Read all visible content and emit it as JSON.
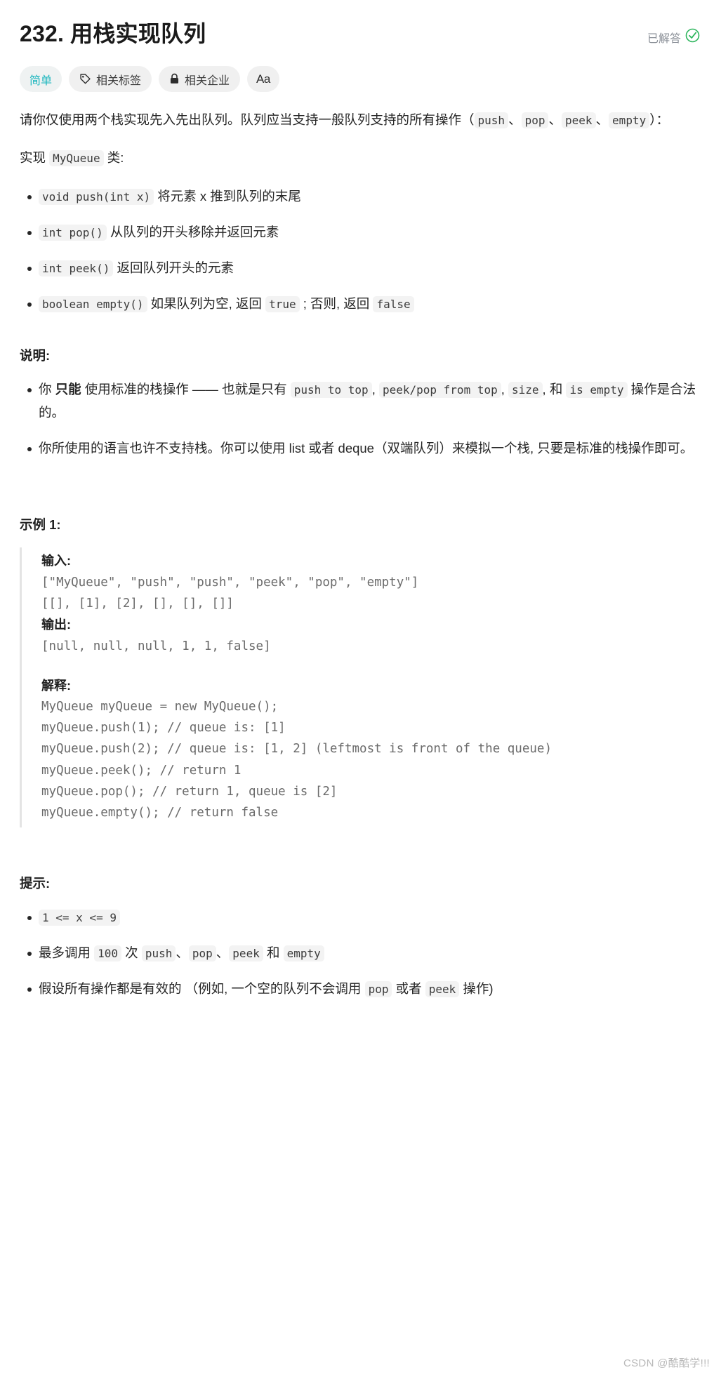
{
  "header": {
    "title": "232. 用栈实现队列",
    "solved_label": "已解答",
    "solved_icon": "check-circle-icon",
    "accent_color": "#18b5bd",
    "solved_color": "#8a8f97",
    "check_color": "#2db55d"
  },
  "badges": [
    {
      "label": "简单",
      "icon": null,
      "kind": "difficulty"
    },
    {
      "label": "相关标签",
      "icon": "tag-icon",
      "kind": "normal"
    },
    {
      "label": "相关企业",
      "icon": "lock-icon",
      "kind": "normal"
    },
    {
      "label": "Aa",
      "icon": "font-size-icon",
      "kind": "icon-only"
    }
  ],
  "intro": {
    "line1_a": "请你仅使用两个栈实现先入先出队列。队列应当支持一般队列支持的所有操作",
    "paren_open": "（",
    "code_push": "push",
    "sep1": "、",
    "code_pop": "pop",
    "sep2": "、",
    "code_peek": "peek",
    "sep3": "、",
    "code_empty": "empty",
    "paren_close": "）：",
    "impl_prefix": "实现 ",
    "impl_code": "MyQueue",
    "impl_suffix": " 类:"
  },
  "methods": [
    {
      "code": "void push(int x)",
      "text": "将元素 x 推到队列的末尾"
    },
    {
      "code": "int pop()",
      "text": "从队列的开头移除并返回元素"
    },
    {
      "code": "int peek()",
      "text": "返回队列开头的元素"
    }
  ],
  "method_empty": {
    "code": "boolean empty()",
    "text_a": "如果队列为空, 返回 ",
    "code_true": "true",
    "text_b": " ; 否则, 返回 ",
    "code_false": "false"
  },
  "notes": {
    "heading": "说明:",
    "item1": {
      "a": "你 ",
      "bold": "只能",
      "b": " 使用标准的栈操作 —— 也就是只有 ",
      "code1": "push to top",
      "c": ", ",
      "code2": "peek/pop from top",
      "d": ", ",
      "code3": "size",
      "e": ", 和 ",
      "code4": "is empty",
      "f": " 操作是合法的。"
    },
    "item2": "你所使用的语言也许不支持栈。你可以使用 list 或者 deque（双端队列）来模拟一个栈, 只要是标准的栈操作即可。"
  },
  "example": {
    "heading": "示例 1:",
    "input_label": "输入:",
    "input_lines": "[\"MyQueue\", \"push\", \"push\", \"peek\", \"pop\", \"empty\"]\n[[], [1], [2], [], [], []]",
    "output_label": "输出:",
    "output_lines": "[null, null, null, 1, 1, false]",
    "explain_label": "解释:",
    "explain_lines": "MyQueue myQueue = new MyQueue();\nmyQueue.push(1); // queue is: [1]\nmyQueue.push(2); // queue is: [1, 2] (leftmost is front of the queue)\nmyQueue.peek(); // return 1\nmyQueue.pop(); // return 1, queue is [2]\nmyQueue.empty(); // return false"
  },
  "hints": {
    "heading": "提示:",
    "item1_code": "1 <= x <= 9",
    "item2": {
      "a": "最多调用 ",
      "code1": "100",
      "b": " 次 ",
      "code2": "push",
      "c": "、",
      "code3": "pop",
      "d": "、",
      "code4": "peek",
      "e": " 和 ",
      "code5": "empty"
    },
    "item3": {
      "a": "假设所有操作都是有效的 （例如, 一个空的队列不会调用 ",
      "code1": "pop",
      "b": " 或者 ",
      "code2": "peek",
      "c": " 操作)"
    }
  },
  "watermark": "CSDN @酷酷学!!!"
}
